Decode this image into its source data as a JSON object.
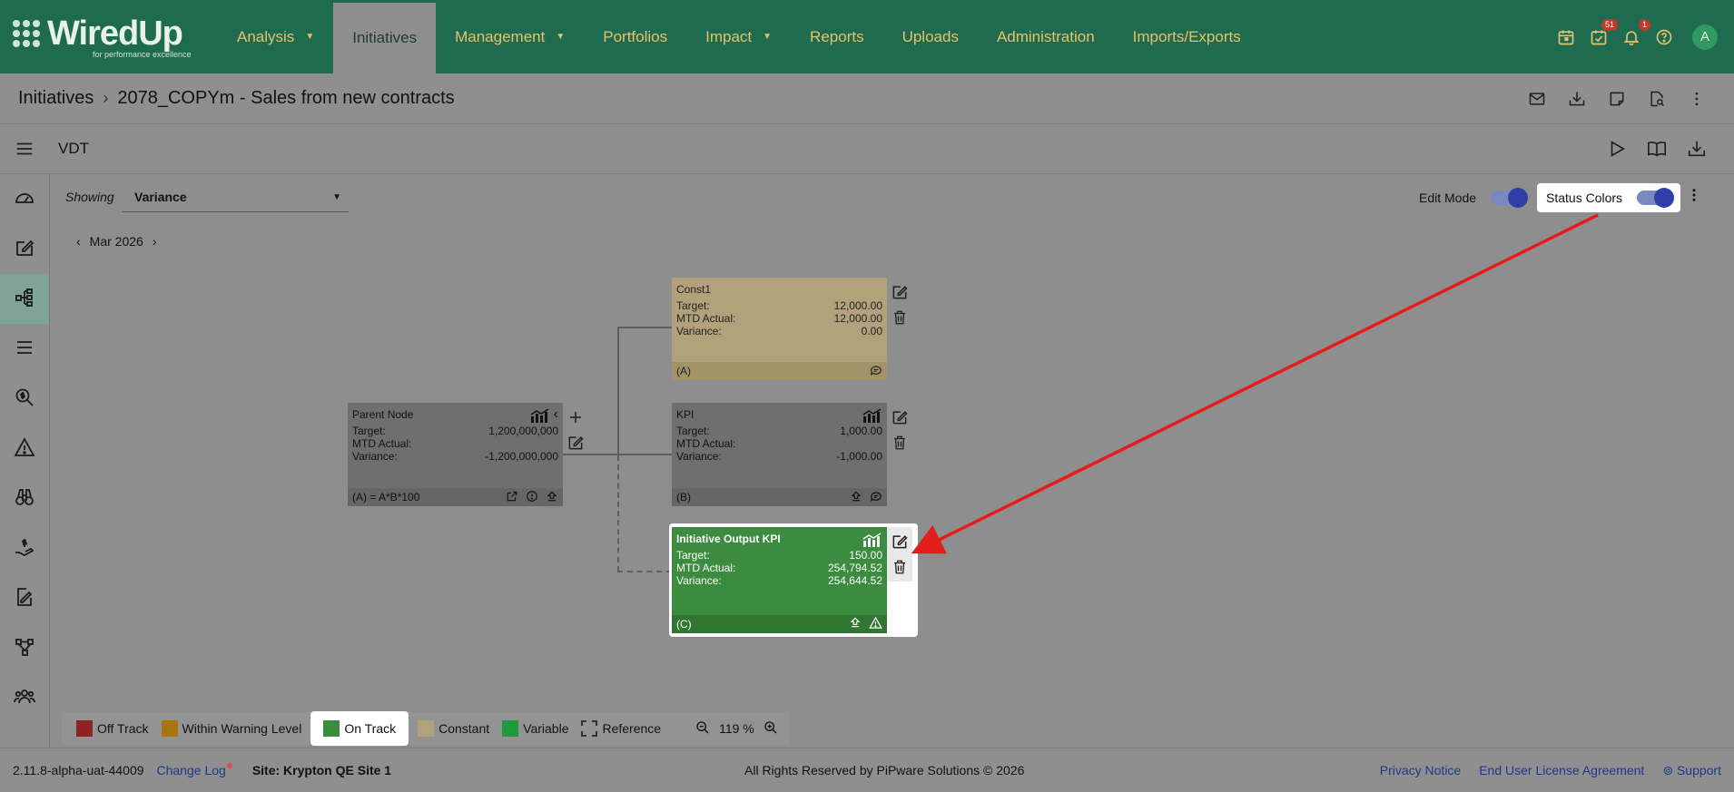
{
  "app": {
    "logo_text": "WiredUp",
    "logo_tagline": "for performance excellence"
  },
  "nav": {
    "items": [
      {
        "label": "Analysis",
        "has_caret": true
      },
      {
        "label": "Initiatives",
        "active": true
      },
      {
        "label": "Management",
        "has_caret": true
      },
      {
        "label": "Portfolios"
      },
      {
        "label": "Impact",
        "has_caret": true
      },
      {
        "label": "Reports"
      },
      {
        "label": "Uploads"
      },
      {
        "label": "Administration"
      },
      {
        "label": "Imports/Exports"
      }
    ],
    "tasks_badge": "51",
    "notifications_badge": "1",
    "avatar_initial": "A"
  },
  "breadcrumb": {
    "root": "Initiatives",
    "current": "2078_COPYm - Sales from new contracts"
  },
  "vdt": {
    "title": "VDT"
  },
  "toolbar": {
    "showing_label": "Showing",
    "showing_value": "Variance",
    "period": "Mar 2026",
    "edit_mode_label": "Edit Mode",
    "status_colors_label": "Status Colors"
  },
  "nodes": {
    "const1": {
      "title": "Const1",
      "target_label": "Target:",
      "target": "12,000.00",
      "actual_label": "MTD Actual:",
      "actual": "12,000.00",
      "variance_label": "Variance:",
      "variance": "0.00",
      "footer": "(A)"
    },
    "parent": {
      "title": "Parent Node",
      "target_label": "Target:",
      "target": "1,200,000,000",
      "actual_label": "MTD Actual:",
      "actual": "",
      "variance_label": "Variance:",
      "variance": "-1,200,000,000",
      "footer": "(A) = A*B*100"
    },
    "kpi": {
      "title": "KPI",
      "target_label": "Target:",
      "target": "1,000.00",
      "actual_label": "MTD Actual:",
      "actual": "",
      "variance_label": "Variance:",
      "variance": "-1,000.00",
      "footer": "(B)"
    },
    "initiative": {
      "title": "Initiative Output KPI",
      "target_label": "Target:",
      "target": "150.00",
      "actual_label": "MTD Actual:",
      "actual": "254,794.52",
      "variance_label": "Variance:",
      "variance": "254,644.52",
      "footer": "(C)"
    }
  },
  "legend": {
    "items": [
      {
        "label": "Off Track",
        "color": "#8f2323"
      },
      {
        "label": "Within Warning Level",
        "color": "#a8740f"
      },
      {
        "label": "On Track",
        "color": "#3b8c3f"
      },
      {
        "label": "Constant",
        "color": "#b2a27b"
      },
      {
        "label": "Variable",
        "color": "#1e9a3c"
      },
      {
        "label": "Reference"
      }
    ],
    "zoom": "119 %"
  },
  "footer": {
    "version": "2.11.8-alpha-uat-44009",
    "changelog": "Change Log",
    "site": "Site: Krypton QE Site 1",
    "copyright": "All Rights Reserved by PiPware Solutions © 2026",
    "privacy": "Privacy Notice",
    "eula": "End User License Agreement",
    "support": "Support"
  },
  "colors": {
    "brand": "#1f6b4f",
    "nav_text": "#e6c26a",
    "annotation": "#e31c1c",
    "toggle_on": "#2f3fa8"
  }
}
